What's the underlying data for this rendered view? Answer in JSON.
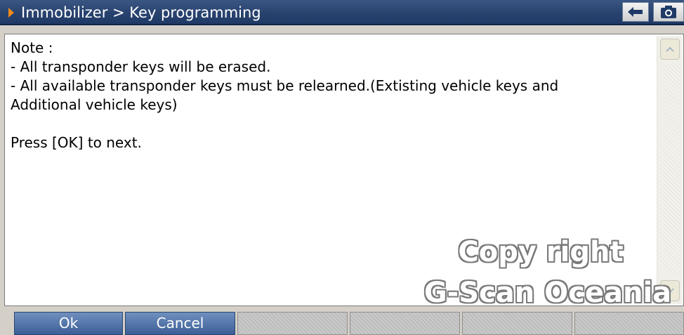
{
  "header": {
    "title": "Immobilizer > Key programming",
    "back_icon": "back-arrow-icon",
    "camera_icon": "camera-icon",
    "accent_color": "#f08a1c"
  },
  "message": {
    "lines": [
      "Note :",
      "- All transponder keys will be erased.",
      "- All available transponder keys must be relearned.(Extisting vehicle keys and",
      "Additional vehicle keys)",
      "",
      "Press [OK] to next."
    ]
  },
  "watermark": {
    "line1": "Copy right",
    "line2": "G-Scan Oceania"
  },
  "buttons": {
    "ok": "Ok",
    "cancel": "Cancel"
  }
}
